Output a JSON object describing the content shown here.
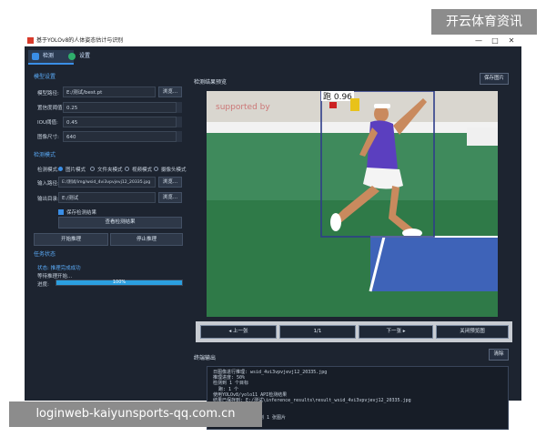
{
  "watermark_top": "开云体育资讯",
  "watermark_bottom": "loginweb-kaiyunsports-qq.com.cn",
  "window": {
    "title": "基于YOLOv8的人体姿态估计与识别",
    "controls": [
      "—",
      "□",
      "✕"
    ]
  },
  "tabs": [
    {
      "label": "检测",
      "active": true
    },
    {
      "label": "设置",
      "active": false
    }
  ],
  "model_settings": {
    "header": "模型设置",
    "model_path_label": "模型路径:",
    "model_path_value": "E:/测试/best.pt",
    "browse_label": "浏览...",
    "conf_label": "置信度阈值:",
    "conf_value": "0.25",
    "iou_label": "IOU阈值:",
    "iou_value": "0.45",
    "imgsz_label": "图像尺寸:",
    "imgsz_value": "640"
  },
  "detect_mode": {
    "header": "检测模式",
    "mode_label": "检测模式:",
    "modes": [
      "图片模式",
      "文件夹模式",
      "视频模式",
      "摄像头模式"
    ],
    "selected_index": 0,
    "input_label": "输入路径:",
    "input_value": "E:/测试/img/wsid_4vi3vpvjevj12_20335.jpg",
    "output_label": "输出目录:",
    "output_value": "E:/测试",
    "browse_label": "浏览...",
    "save_checkbox": "保存检测结果",
    "view_results_button": "查看检测结果",
    "start_button": "开始推理",
    "stop_button": "停止推理"
  },
  "task_status": {
    "header": "任务状态",
    "status_line": "状态: 推理完成成功",
    "wait_line": "等待推理开始...",
    "progress_label": "进度:",
    "progress_text": "100%",
    "progress_value": 1.0
  },
  "preview": {
    "header": "检测结果预览",
    "save_button": "保存图片",
    "detection_label": "跑 0.96"
  },
  "navigation": {
    "prev": "◂ 上一张",
    "counter": "1/1",
    "next": "下一张 ▸",
    "close": "关闭预览图"
  },
  "terminal": {
    "header": "终端输出",
    "clear_button": "清除",
    "lines": [
      "日图像进行推理: wsid_4vi3vpvjevj12_20335.jpg",
      "推理进度: 50%",
      "检测到 1 个目标",
      "  跑: 1 个",
      "使用YOLOv8/yolo11 API检测结果",
      "结果已保存到: E:/测试\\inference_results\\result_wsid_4vi3vpvjevj12_20335.jpg",
      "推理进度: 100%",
      "推理完成",
      "打开图片浏览器, 共找到 1 张图片"
    ]
  },
  "colors": {
    "window_bg": "#1d2430",
    "accent": "#3a8ee6",
    "section_header": "#5aa9f5",
    "box_outline": "#2f3d8a"
  }
}
